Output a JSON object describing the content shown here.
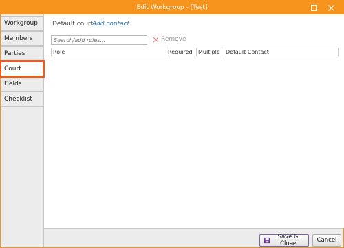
{
  "window": {
    "title": "Edit Workgroup - [Test]",
    "accent_color": "#f7941d",
    "maximize_icon": "maximize-icon",
    "close_icon": "close-icon"
  },
  "tabs": [
    {
      "label": "Workgroup"
    },
    {
      "label": "Members"
    },
    {
      "label": "Parties"
    },
    {
      "label": "Court",
      "active": true
    },
    {
      "label": "Fields"
    },
    {
      "label": "Checklist"
    }
  ],
  "court": {
    "default_court_label": "Default court",
    "add_contact_label": "Add contact",
    "search_placeholder": "Search/add roles...",
    "remove_label": "Remove",
    "columns": [
      "Role",
      "Required",
      "Multiple",
      "Default Contact"
    ]
  },
  "footer": {
    "save_label": "Save & Close",
    "cancel_label": "Cancel"
  },
  "colors": {
    "highlight": "#ef5b1e",
    "link": "#1f6fb8"
  }
}
